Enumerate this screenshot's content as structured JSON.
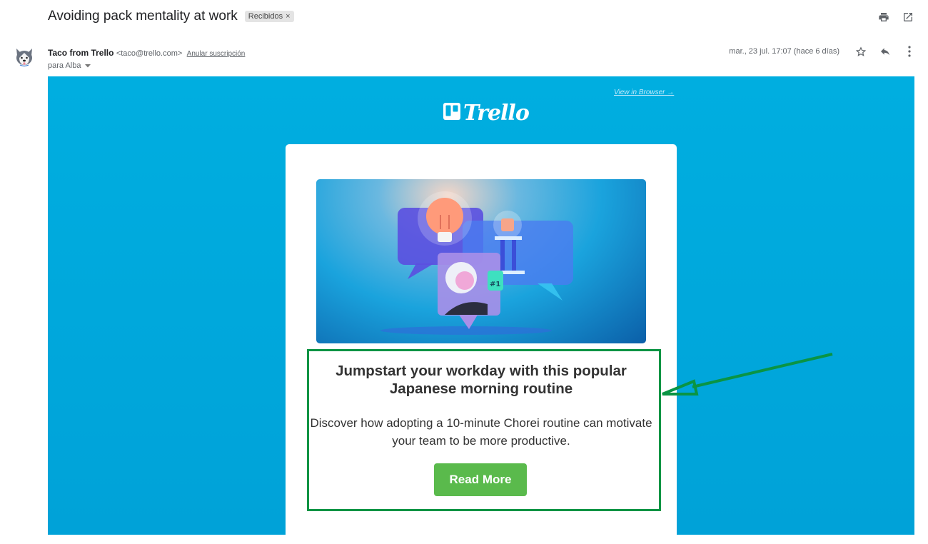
{
  "header": {
    "subject": "Avoiding pack mentality at work",
    "label": "Recibidos",
    "label_remove": "×",
    "actions": [
      {
        "name": "print-icon",
        "title": "Imprimir"
      },
      {
        "name": "open-new-window-icon",
        "title": "En una ventana nueva"
      }
    ]
  },
  "message": {
    "sender_name": "Taco from Trello",
    "sender_email": "<taco@trello.com>",
    "unsubscribe": "Anular suscripción",
    "recipient": "para Alba",
    "date": "mar., 23 jul. 17:07 (hace 6 días)",
    "avatar_icon": "husky-avatar-icon",
    "actions": [
      "star-icon",
      "reply-icon",
      "more-vert-icon"
    ]
  },
  "email": {
    "view_in_browser": "View in Browser →",
    "brand": "Trello",
    "hero_alt": "Illustration of speech bubbles with a lightbulb, a trophy and a person holding a #1 foam finger",
    "hero_badge": "#1",
    "headline": "Jumpstart your workday with this popular Japanese morning routine",
    "description": "Discover how adopting a 10-minute Chorei routine can motivate your team to be more productive.",
    "cta": "Read More"
  },
  "colors": {
    "email_bg": "#00aee0",
    "cta": "#5aba4c",
    "annotation": "#0a9444"
  }
}
